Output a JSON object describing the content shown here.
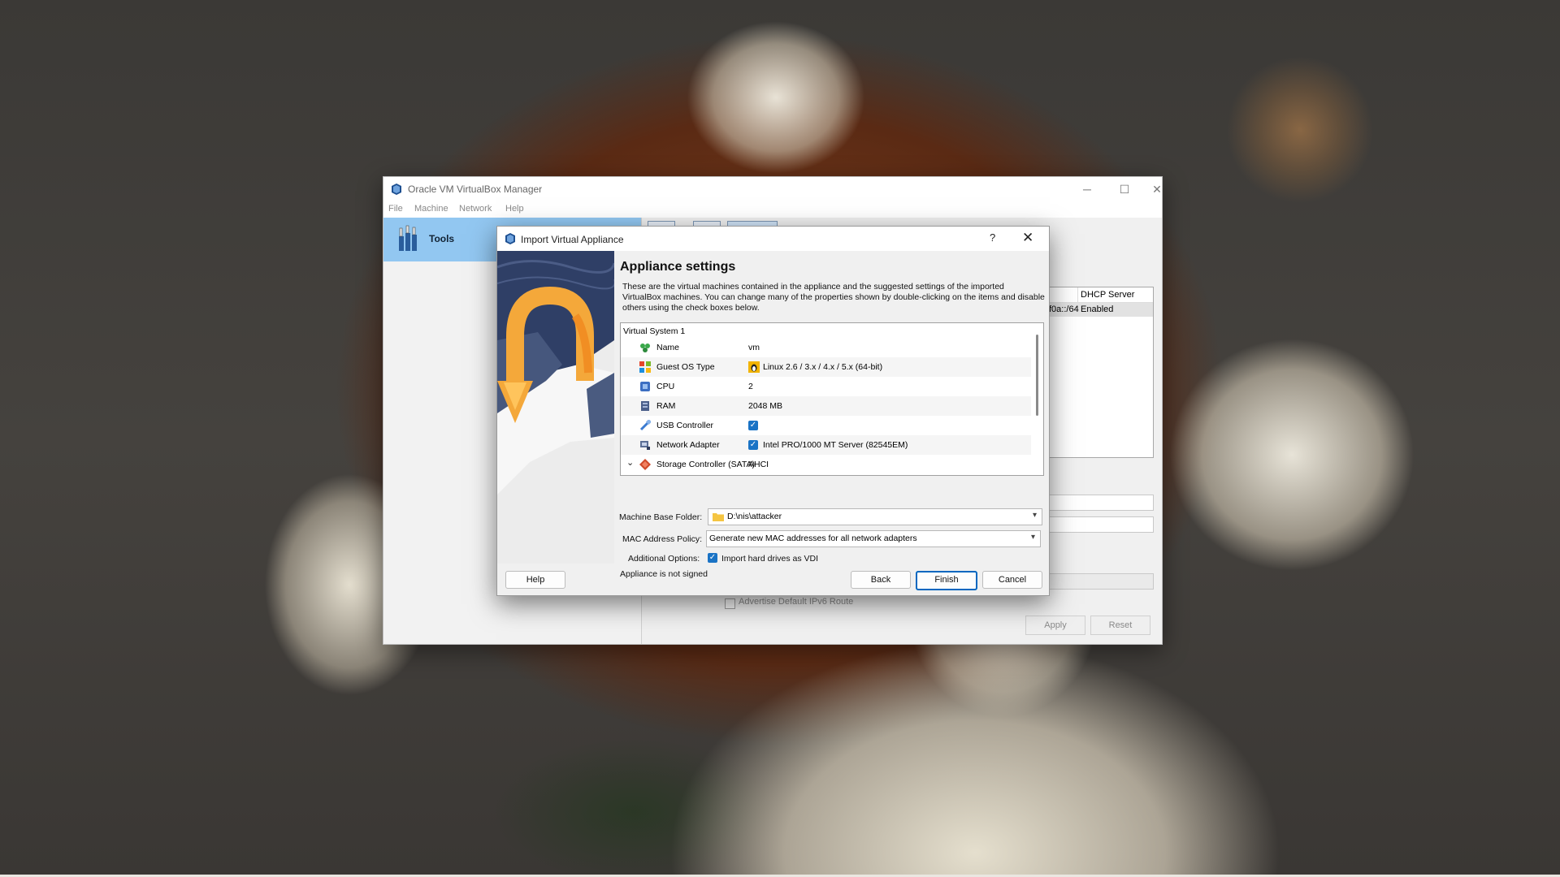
{
  "main_window": {
    "title": "Oracle VM VirtualBox Manager",
    "menu": [
      "File",
      "Machine",
      "Network",
      "Help"
    ],
    "sidebar": {
      "tools_label": "Tools"
    },
    "network_table": {
      "header": "DHCP Server",
      "row_ip": "f0a::/64",
      "row_dhcp": "Enabled"
    },
    "advertise_label": "Advertise Default IPv6 Route",
    "apply_label": "Apply",
    "reset_label": "Reset"
  },
  "dialog": {
    "title": "Import Virtual Appliance",
    "help_glyph": "?",
    "close_glyph": "✕",
    "heading": "Appliance settings",
    "description": "These are the virtual machines contained in the appliance and the suggested settings of the imported VirtualBox machines. You can change many of the properties shown by double-clicking on the items and disable others using the check boxes below.",
    "tree": {
      "group": "Virtual System 1",
      "rows": [
        {
          "label": "Name",
          "value": "vm",
          "icon": "name-icon"
        },
        {
          "label": "Guest OS Type",
          "value": "Linux 2.6 / 3.x / 4.x / 5.x (64-bit)",
          "icon": "os-type-icon"
        },
        {
          "label": "CPU",
          "value": "2",
          "icon": "cpu-icon"
        },
        {
          "label": "RAM",
          "value": "2048 MB",
          "icon": "ram-icon"
        },
        {
          "label": "USB Controller",
          "value": "",
          "icon": "usb-icon",
          "checked": true
        },
        {
          "label": "Network Adapter",
          "value": "Intel PRO/1000 MT Server (82545EM)",
          "icon": "network-adapter-icon",
          "checked": true
        },
        {
          "label": "Storage Controller (SATA)",
          "value": "AHCI",
          "icon": "storage-icon"
        }
      ]
    },
    "machine_base_folder": {
      "label": "Machine Base Folder:",
      "value": "D:\\nis\\attacker"
    },
    "mac_policy": {
      "label": "MAC Address Policy:",
      "value": "Generate new MAC addresses for all network adapters"
    },
    "additional_options": {
      "label": "Additional Options:",
      "checkbox_label": "Import hard drives as VDI",
      "checked": true
    },
    "signature_status": "Appliance is not signed",
    "buttons": {
      "help": "Help",
      "back": "Back",
      "finish": "Finish",
      "cancel": "Cancel"
    }
  },
  "colors": {
    "tools_selected": "#92c7f1",
    "checkbox_blue": "#1a73c5",
    "primary_button_border": "#0067c0",
    "wizard_arrow_orange": "#f4a83a"
  }
}
